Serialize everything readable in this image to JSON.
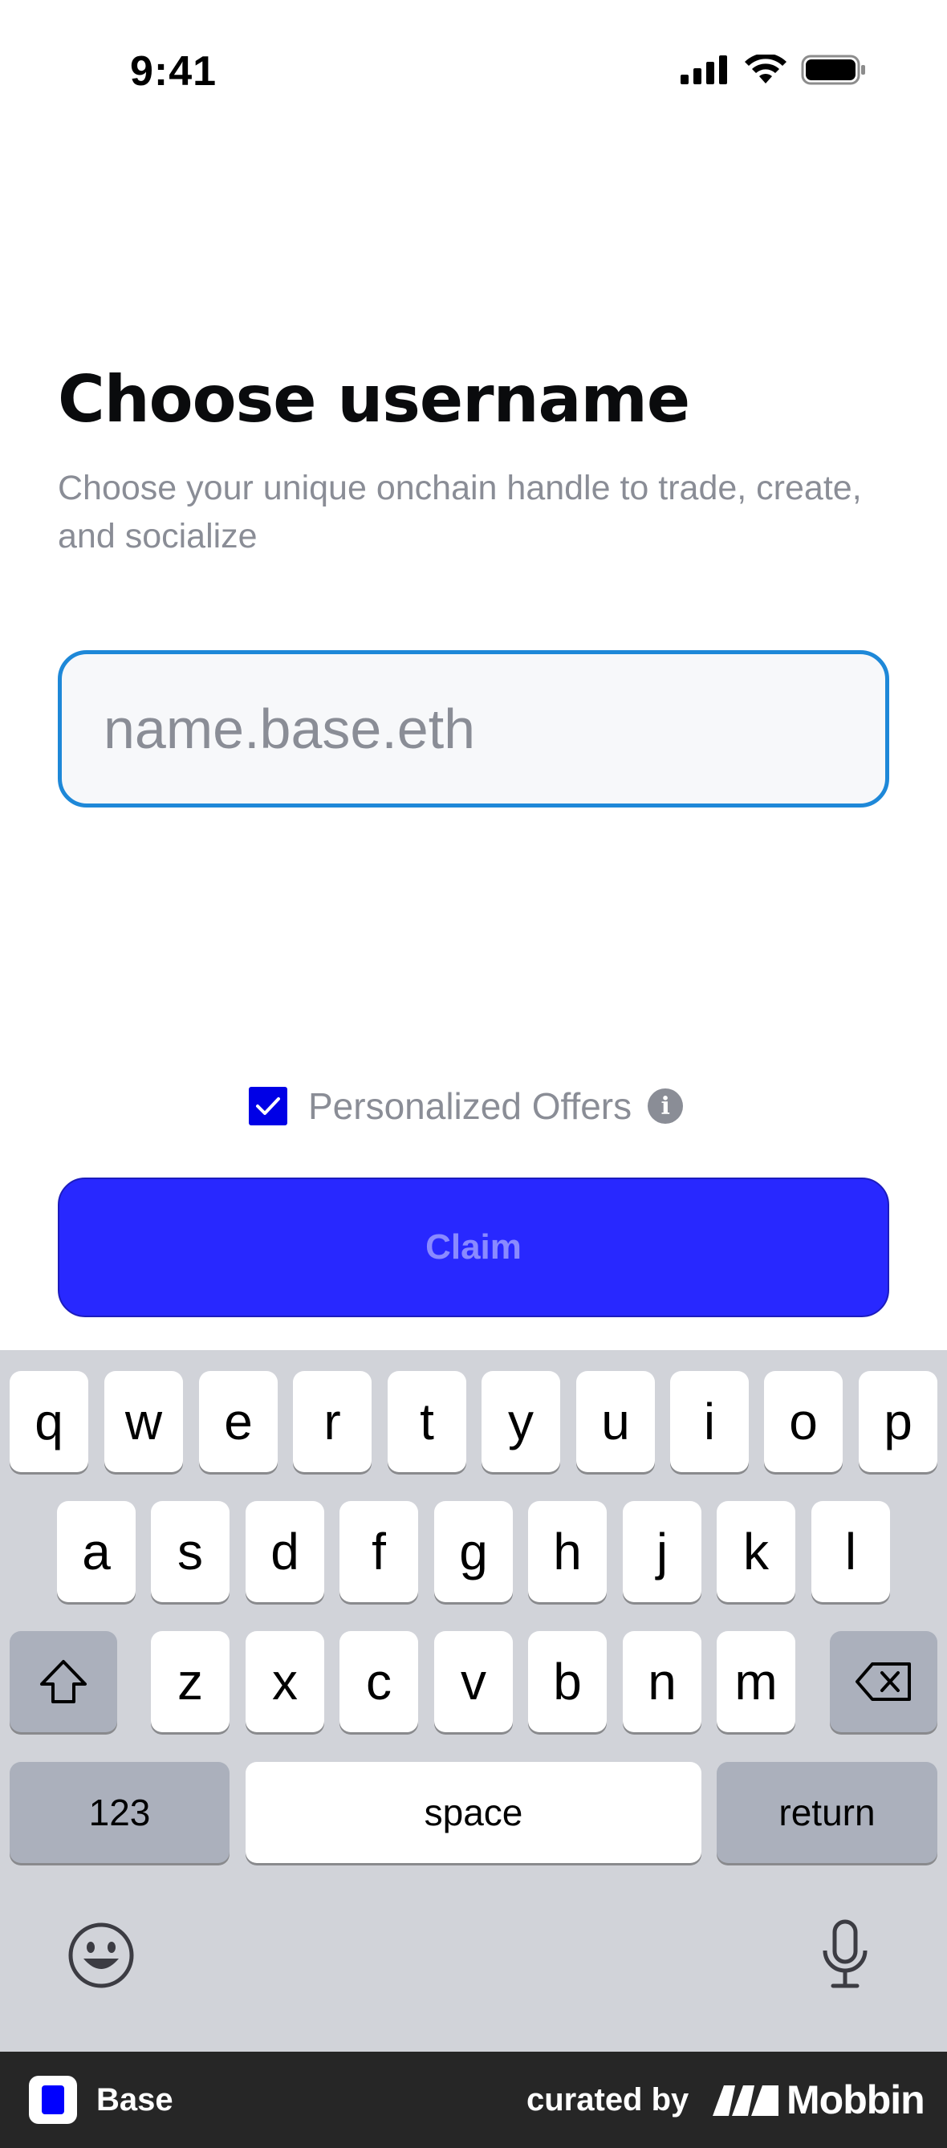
{
  "status_bar": {
    "time": "9:41"
  },
  "header": {
    "title": "Choose username",
    "subtitle": "Choose your unique onchain handle to trade, create, and socialize"
  },
  "username_input": {
    "placeholder": "name.base.eth",
    "value": ""
  },
  "offers": {
    "label": "Personalized Offers",
    "checked": true
  },
  "claim_button": {
    "label": "Claim"
  },
  "keyboard": {
    "row1": [
      "q",
      "w",
      "e",
      "r",
      "t",
      "y",
      "u",
      "i",
      "o",
      "p"
    ],
    "row2": [
      "a",
      "s",
      "d",
      "f",
      "g",
      "h",
      "j",
      "k",
      "l"
    ],
    "row3": [
      "z",
      "x",
      "c",
      "v",
      "b",
      "n",
      "m"
    ],
    "numbers_key": "123",
    "space_key": "space",
    "return_key": "return"
  },
  "footer": {
    "app_name": "Base",
    "curated_by": "curated by",
    "brand": "Mobbin"
  },
  "colors": {
    "accent": "#2828ff",
    "input_border": "#1e88d8",
    "muted_text": "#8a8d96",
    "keyboard_bg": "#d1d3d9"
  }
}
